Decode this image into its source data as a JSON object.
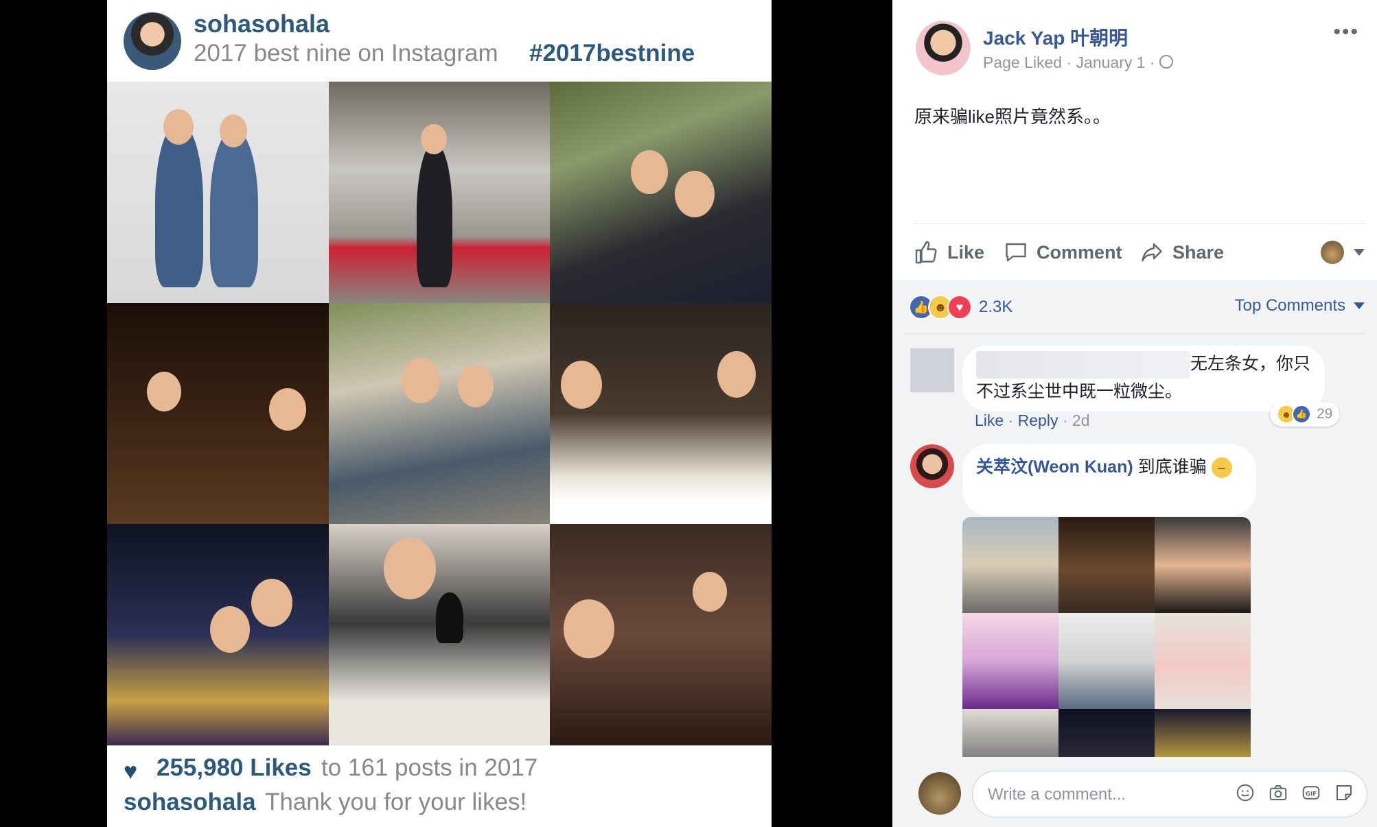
{
  "instagram": {
    "username": "sohasohala",
    "subtitle": "2017 best nine on Instagram",
    "hashtag": "#2017bestnine",
    "likes_count": "255,980 Likes",
    "likes_rest": "to 161 posts in 2017",
    "footer_user": "sohasohala",
    "footer_text": "Thank you for your likes!"
  },
  "post": {
    "author": "Jack Yap 叶朝明",
    "meta": "Page Liked · January 1 ·",
    "text": "原来骗like照片竟然系。。",
    "actions": {
      "like": "Like",
      "comment": "Comment",
      "share": "Share"
    },
    "reaction_count": "2.3K",
    "sort_label": "Top Comments"
  },
  "comments": [
    {
      "text_line1": "无左条女，你只",
      "text_line2": "不过系尘世中既一粒微尘。",
      "like": "Like",
      "reply": "Reply",
      "time": "2d",
      "reactions": "29"
    },
    {
      "name": "关萃汶(Weon Kuan)",
      "text": "到底谁骗"
    }
  ],
  "composer": {
    "placeholder": "Write a comment..."
  }
}
